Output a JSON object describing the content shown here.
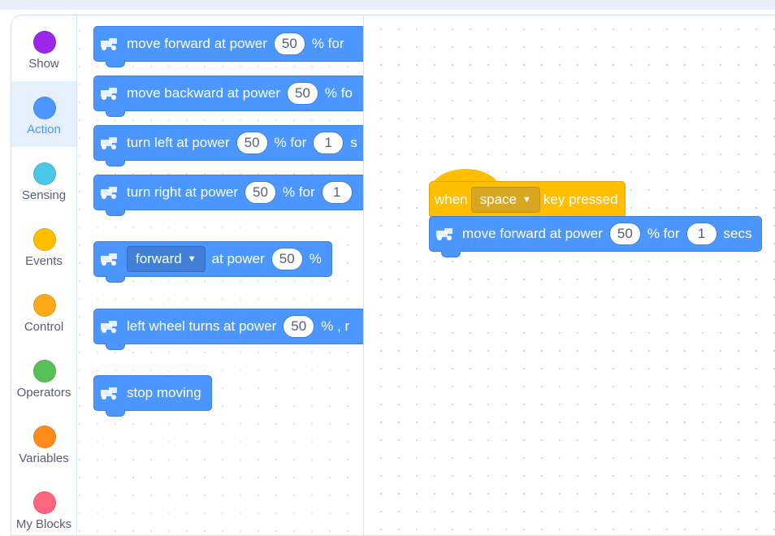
{
  "categories": [
    {
      "label": "Show",
      "color": "#9c27e8",
      "selected": false
    },
    {
      "label": "Action",
      "color": "#4c97ff",
      "selected": true
    },
    {
      "label": "Sensing",
      "color": "#4cc7e8",
      "selected": false
    },
    {
      "label": "Events",
      "color": "#ffbf00",
      "selected": false
    },
    {
      "label": "Control",
      "color": "#ffab19",
      "selected": false
    },
    {
      "label": "Operators",
      "color": "#59c059",
      "selected": false
    },
    {
      "label": "Variables",
      "color": "#ff8c1a",
      "selected": false
    },
    {
      "label": "My Blocks",
      "color": "#ff6680",
      "selected": false
    }
  ],
  "palette": {
    "move_forward": {
      "text": "move forward at power",
      "power": "50",
      "tail": "% for"
    },
    "move_backward": {
      "text": "move backward at power",
      "power": "50",
      "tail": "% fo"
    },
    "turn_left": {
      "text": "turn left at power",
      "power": "50",
      "mid": "% for",
      "secs": "1",
      "tail": "s"
    },
    "turn_right": {
      "text": "turn right at power",
      "power": "50",
      "mid": "% for",
      "secs": "1"
    },
    "direction_power": {
      "dropdown": "forward",
      "text": "at power",
      "power": "50",
      "tail": "%"
    },
    "left_wheel": {
      "text": "left wheel turns at power",
      "power": "50",
      "tail": "% , r"
    },
    "stop_moving": {
      "text": "stop moving"
    }
  },
  "script": {
    "hat": {
      "when": "when",
      "key": "space",
      "tail": "key pressed"
    },
    "move": {
      "text": "move forward at power",
      "power": "50",
      "mid": "% for",
      "secs": "1",
      "tail": "secs"
    }
  },
  "colors": {
    "motion": "#4c97ff",
    "events": "#ffbf00"
  }
}
